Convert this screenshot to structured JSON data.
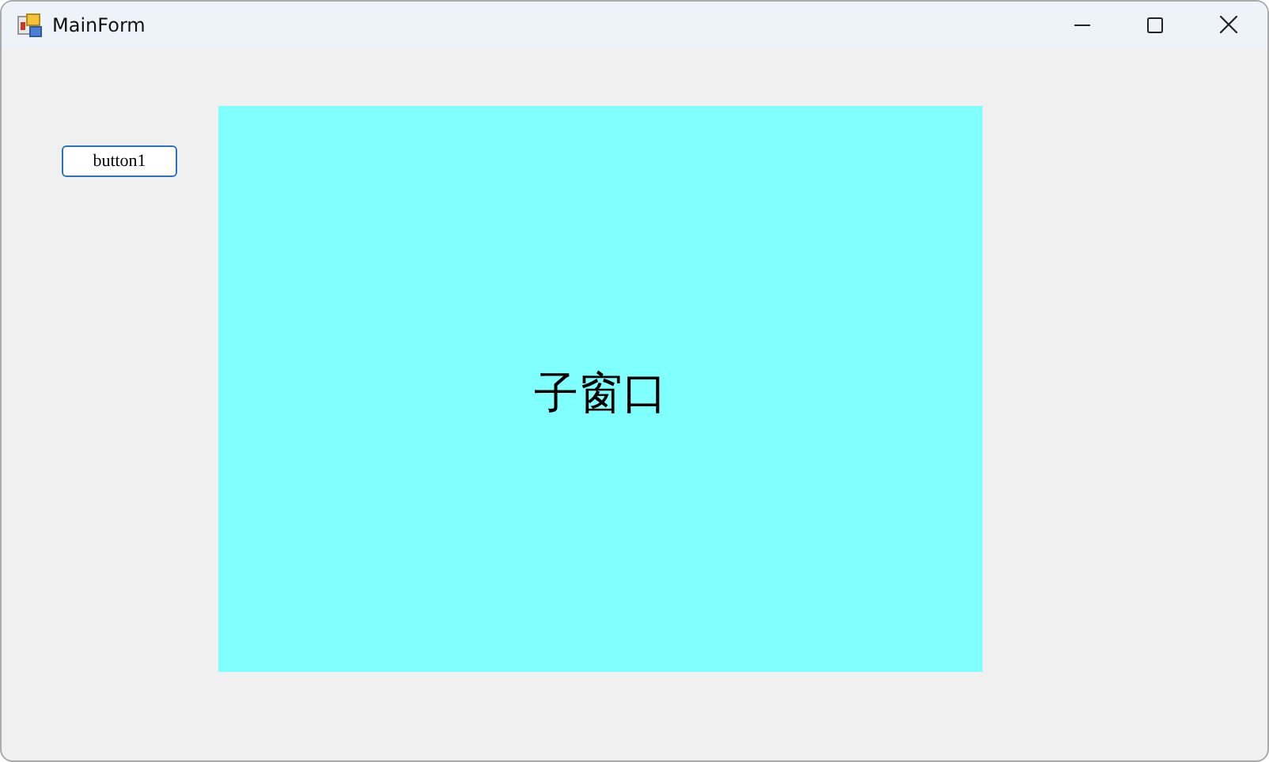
{
  "window": {
    "title": "MainForm"
  },
  "button": {
    "label": "button1"
  },
  "child_panel": {
    "label": "子窗口"
  }
}
